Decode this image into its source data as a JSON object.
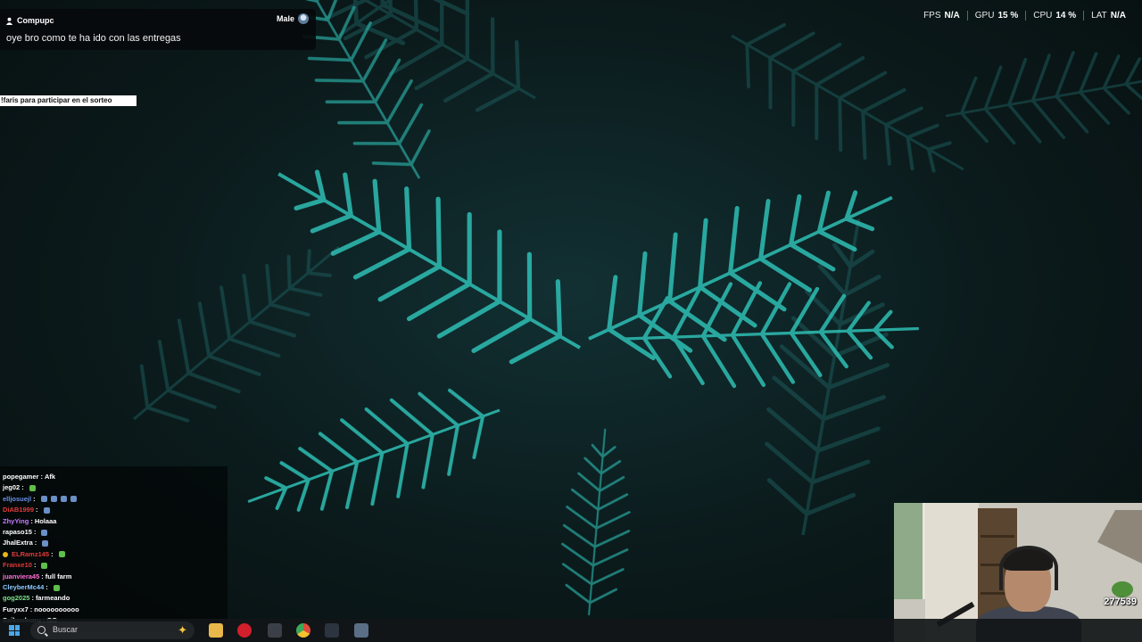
{
  "notification": {
    "username": "Compupc",
    "gender": "Male",
    "message": "oye bro como te ha ido con las entregas"
  },
  "raffle_banner": "!faris para participar en el sorteo",
  "stats": [
    {
      "label": "FPS",
      "value": "N/A"
    },
    {
      "label": "GPU",
      "value": "15 %"
    },
    {
      "label": "CPU",
      "value": "14 %"
    },
    {
      "label": "LAT",
      "value": "N/A"
    }
  ],
  "chat": [
    {
      "user": "popegamer",
      "color": "#ffffff",
      "message": "Afk",
      "emotes": []
    },
    {
      "user": "jeg02",
      "color": "#ffffff",
      "message": "",
      "emotes": [
        "green"
      ]
    },
    {
      "user": "elljosuejl",
      "color": "#6b8fe8",
      "message": "",
      "emotes": [
        "blue",
        "blue",
        "blue",
        "blue"
      ]
    },
    {
      "user": "DiAB1999",
      "color": "#e03b3b",
      "message": "",
      "emotes": [
        "blue"
      ]
    },
    {
      "user": "ZhyYing",
      "color": "#c77dff",
      "message": "Holaaa",
      "emotes": []
    },
    {
      "user": "rapaso15",
      "color": "#ffffff",
      "message": "",
      "emotes": [
        "blue"
      ]
    },
    {
      "user": "JhalExtra",
      "color": "#ffffff",
      "message": "",
      "emotes": [
        "blue"
      ]
    },
    {
      "user": "ELRamz145",
      "color": "#e03b3b",
      "message": "",
      "emotes": [
        "green"
      ],
      "badge": true
    },
    {
      "user": "Franxe10",
      "color": "#e03b3b",
      "message": "",
      "emotes": [
        "green"
      ]
    },
    {
      "user": "juanviera45",
      "color": "#ff6fd8",
      "message": "full farm",
      "emotes": []
    },
    {
      "user": "CleyberMc44",
      "color": "#8ec8ff",
      "message": "",
      "emotes": [
        "green"
      ]
    },
    {
      "user": "gog2025",
      "color": "#7fe08a",
      "message": "farmeando",
      "emotes": []
    },
    {
      "user": "Furyxx7",
      "color": "#ffffff",
      "message": "noooooooooo",
      "emotes": []
    },
    {
      "user": "Saikonlnaru",
      "color": "#ffffff",
      "message": "GG",
      "emotes": []
    }
  ],
  "webcam": {
    "counter": "277539"
  },
  "taskbar": {
    "search_placeholder": "Buscar",
    "apps": [
      "file-explorer-icon",
      "opera-icon",
      "app-icon",
      "chrome-icon",
      "store-icon",
      "calculator-icon"
    ]
  }
}
